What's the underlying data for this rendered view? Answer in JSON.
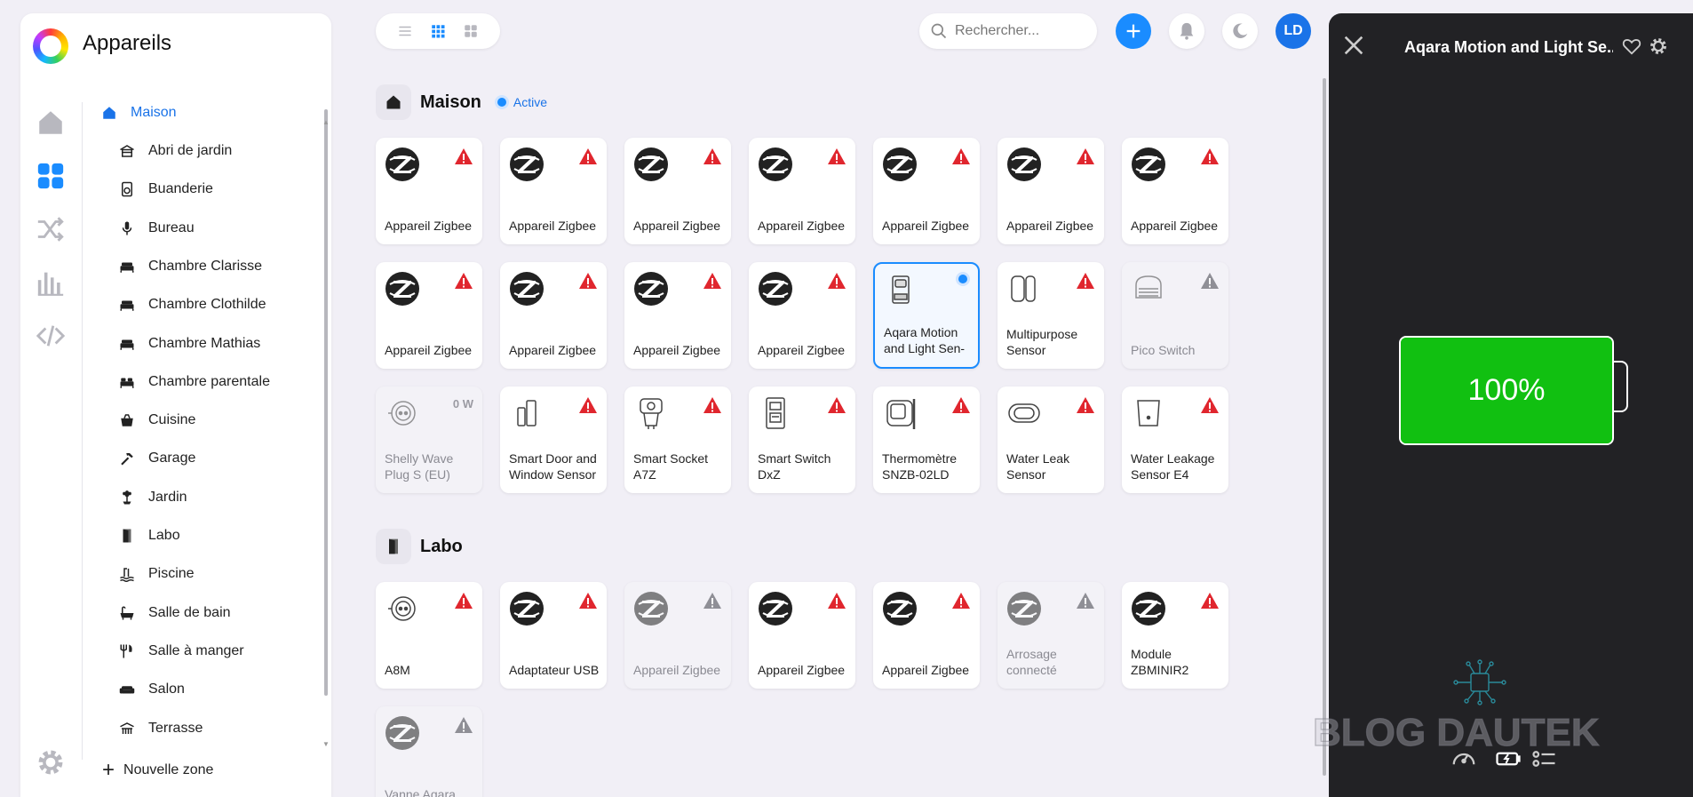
{
  "app": {
    "title": "Appareils"
  },
  "rail": {
    "items": [
      {
        "name": "home-icon"
      },
      {
        "name": "devices-grid-icon",
        "active": true
      },
      {
        "name": "shuffle-icon"
      },
      {
        "name": "chart-bars-icon"
      },
      {
        "name": "code-icon"
      },
      {
        "name": "gear-icon"
      }
    ]
  },
  "zones": {
    "root": "Maison",
    "items": [
      "Abri de jardin",
      "Buanderie",
      "Bureau",
      "Chambre Clarisse",
      "Chambre Clothilde",
      "Chambre Mathias",
      "Chambre parentale",
      "Cuisine",
      "Garage",
      "Jardin",
      "Labo",
      "Piscine",
      "Salle de bain",
      "Salle à manger",
      "Salon",
      "Terrasse"
    ],
    "new_zone": "Nouvelle zone"
  },
  "search": {
    "placeholder": "Rechercher..."
  },
  "avatar": {
    "initials": "LD"
  },
  "colors": {
    "accent": "#1a8cff",
    "warning": "#e0262e",
    "battery": "#11c011",
    "panel_bg": "#222225"
  },
  "sections": [
    {
      "title": "Maison",
      "status": "Active",
      "devices": [
        {
          "name": "Appareil Zigbee",
          "icon": "zigbee",
          "badge": "warning-red"
        },
        {
          "name": "Appareil Zigbee",
          "icon": "zigbee",
          "badge": "warning-red"
        },
        {
          "name": "Appareil Zigbee",
          "icon": "zigbee",
          "badge": "warning-red"
        },
        {
          "name": "Appareil Zigbee",
          "icon": "zigbee",
          "badge": "warning-red"
        },
        {
          "name": "Appareil Zigbee",
          "icon": "zigbee",
          "badge": "warning-red"
        },
        {
          "name": "Appareil Zigbee",
          "icon": "zigbee",
          "badge": "warning-red"
        },
        {
          "name": "Appareil Zigbee",
          "icon": "zigbee",
          "badge": "warning-red"
        },
        {
          "name": "Appareil Zigbee",
          "icon": "zigbee",
          "badge": "warning-red"
        },
        {
          "name": "Appareil Zigbee",
          "icon": "zigbee",
          "badge": "warning-red"
        },
        {
          "name": "Appareil Zigbee",
          "icon": "zigbee",
          "badge": "warning-red"
        },
        {
          "name": "Appareil Zigbee",
          "icon": "zigbee",
          "badge": "warning-red"
        },
        {
          "name": "Aqara Motion and Light Sen-",
          "icon": "motion-sensor",
          "badge": "active-dot",
          "selected": true
        },
        {
          "name": "Multipurpose Sensor",
          "icon": "multipurpose-sensor",
          "badge": "warning-red"
        },
        {
          "name": "Pico Switch",
          "icon": "pico-switch",
          "badge": "warning-grey",
          "dim": true
        },
        {
          "name": "Shelly Wave Plug S (EU)",
          "icon": "plug",
          "power": "0 W",
          "dim": true
        },
        {
          "name": "Smart Door and Window Sensor",
          "icon": "door-sensor",
          "badge": "warning-red"
        },
        {
          "name": "Smart Socket A7Z",
          "icon": "smart-socket",
          "badge": "warning-red"
        },
        {
          "name": "Smart Switch DxZ",
          "icon": "din-switch",
          "badge": "warning-red"
        },
        {
          "name": "Thermomètre SNZB-02LD",
          "icon": "thermometer",
          "badge": "warning-red"
        },
        {
          "name": "Water Leak Sensor",
          "icon": "water-leak",
          "badge": "warning-red"
        },
        {
          "name": "Water Leakage Sensor E4",
          "icon": "water-leakage",
          "badge": "warning-red"
        }
      ]
    },
    {
      "title": "Labo",
      "devices": [
        {
          "name": "A8M",
          "icon": "plug",
          "badge": "warning-red"
        },
        {
          "name": "Adaptateur USB",
          "icon": "zigbee",
          "badge": "warning-red"
        },
        {
          "name": "Appareil Zigbee",
          "icon": "zigbee",
          "badge": "warning-grey",
          "dim": true
        },
        {
          "name": "Appareil Zigbee",
          "icon": "zigbee",
          "badge": "warning-red"
        },
        {
          "name": "Appareil Zigbee",
          "icon": "zigbee",
          "badge": "warning-red"
        },
        {
          "name": "Arrosage connecté",
          "icon": "zigbee",
          "badge": "warning-grey",
          "dim": true
        },
        {
          "name": "Module ZBMINIR2",
          "icon": "zigbee",
          "badge": "warning-red"
        },
        {
          "name": "Vanne Aqara",
          "icon": "zigbee",
          "badge": "warning-grey",
          "dim": true
        }
      ]
    }
  ],
  "panel": {
    "title": "Aqara Motion and Light Se...",
    "battery_percent": 100,
    "battery_label": "100%",
    "watermark": "BLOG DAUTEK"
  }
}
